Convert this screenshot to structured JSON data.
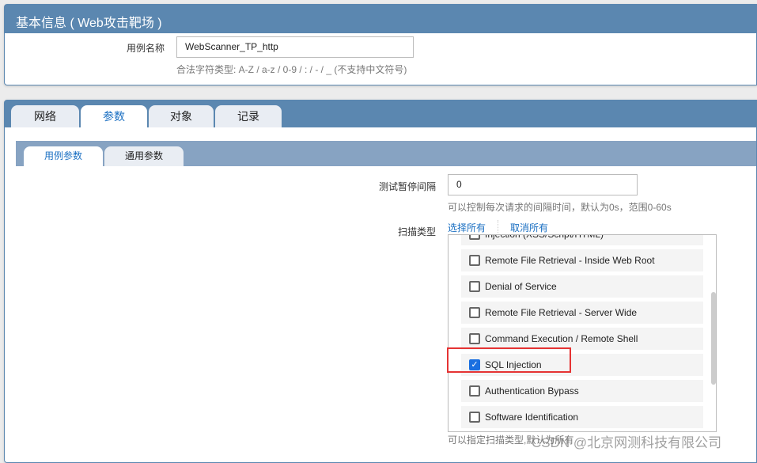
{
  "basic_info": {
    "title": "基本信息 ( Web攻击靶场 )",
    "case_name_label": "用例名称",
    "case_name_value": "WebScanner_TP_http",
    "case_name_hint": "合法字符类型: A-Z / a-z / 0-9 / : / - / _ (不支持中文符号)"
  },
  "tabs": [
    {
      "label": "网络"
    },
    {
      "label": "参数",
      "active": true
    },
    {
      "label": "对象"
    },
    {
      "label": "记录"
    }
  ],
  "subtabs": [
    {
      "label": "用例参数",
      "active": true
    },
    {
      "label": "通用参数"
    }
  ],
  "params": {
    "pause_label": "测试暂停间隔",
    "pause_value": "0",
    "pause_hint": "可以控制每次请求的间隔时间，默认为0s，范围0-60s",
    "scan_type_label": "扫描类型",
    "select_all": "选择所有",
    "deselect_all": "取消所有",
    "scan_types": [
      {
        "label": "Injection (XSS/Script/HTML)",
        "checked": false
      },
      {
        "label": "Remote File Retrieval - Inside Web Root",
        "checked": false
      },
      {
        "label": "Denial of Service",
        "checked": false
      },
      {
        "label": "Remote File Retrieval - Server Wide",
        "checked": false
      },
      {
        "label": "Command Execution / Remote Shell",
        "checked": false
      },
      {
        "label": "SQL Injection",
        "checked": true
      },
      {
        "label": "Authentication Bypass",
        "checked": false
      },
      {
        "label": "Software Identification",
        "checked": false
      }
    ],
    "scan_type_hint": "可以指定扫描类型,默认为所有"
  },
  "watermark": "CSDN @北京网测科技有限公司",
  "colors": {
    "header": "#5b87b0",
    "subheader": "#87a3c2",
    "accent": "#1a6fc2",
    "highlight": "#e53333"
  }
}
